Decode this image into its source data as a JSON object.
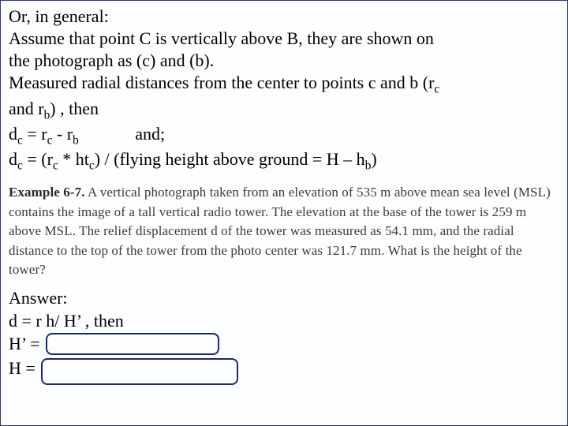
{
  "intro": {
    "line1": "Or, in general:",
    "line2a": "Assume that point C is vertically above B, they are shown on",
    "line2b": "the photograph as (c) and (b).",
    "line3a_pre": "Measured radial distances from the center to points c and b (r",
    "line3a_sub": "c",
    "line3b_pre": "and r",
    "line3b_sub": "b",
    "line3b_post": ") , then"
  },
  "eq1": {
    "lhs_var": "d",
    "lhs_sub": "c",
    "eq": "  = r",
    "sub1": "c",
    "mid": " - r",
    "sub2": "b",
    "gap": "             ",
    "tail": "and;"
  },
  "eq2": {
    "lhs_var": "d",
    "lhs_sub": "c",
    "eq": "  =  (r",
    "sub1": "c",
    "mid1": "  *   ht",
    "sub2": "c",
    "mid2": ") / (flying height above ground = H – h",
    "sub3": "b",
    "tail": ")"
  },
  "example": {
    "label": "Example 6-7.",
    "text": " A vertical photograph taken from an elevation of 535 m above mean sea level (MSL) contains the image of a tall vertical radio tower. The elevation at the base of the tower is 259 m above MSL. The relief displacement d of the tower was measured as 54.1 mm, and the radial distance to the top of the tower from the photo center was 121.7 mm. What is the height of the tower?"
  },
  "answer": {
    "label": "Answer:",
    "line1": "d = r h/ H’  , then",
    "line2_pre": "H’ =",
    "line3_pre": "H ="
  }
}
